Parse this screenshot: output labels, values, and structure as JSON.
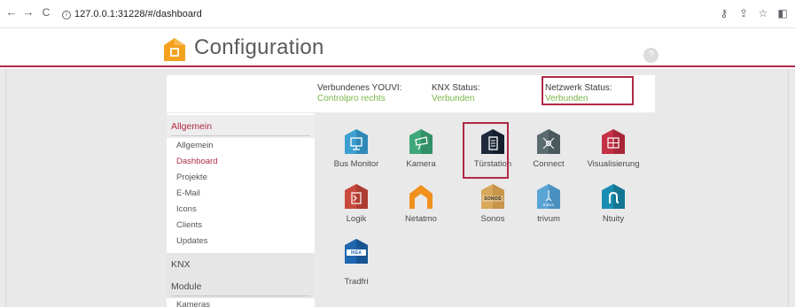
{
  "browser": {
    "back": "←",
    "forward": "→",
    "reload": "C",
    "url": "127.0.0.1:31228/#/dashboard",
    "icons": [
      "key-icon",
      "share-icon",
      "star-icon",
      "sidepanel-icon"
    ]
  },
  "header": {
    "title": "Configuration",
    "help": "?"
  },
  "status": {
    "youvi_label": "Verbundenes YOUVI:",
    "youvi_value": "Controlpro rechts",
    "knx_label": "KNX Status:",
    "knx_value": "Verbunden",
    "net_label": "Netzwerk Status:",
    "net_value": "Verbunden"
  },
  "sidebar": {
    "sections": [
      {
        "label": "Allgemein",
        "active": true
      },
      {
        "label": "KNX",
        "active": false
      },
      {
        "label": "Module",
        "active": false
      }
    ],
    "items": [
      "Allgemein",
      "Dashboard",
      "Projekte",
      "E-Mail",
      "Icons",
      "Clients",
      "Updates"
    ],
    "module_items": [
      "Kameras"
    ]
  },
  "tiles": [
    {
      "label": "Bus Monitor",
      "color": "#3d9fd1"
    },
    {
      "label": "Kamera",
      "color": "#3ea87a"
    },
    {
      "label": "Türstation",
      "color": "#1e2a3c"
    },
    {
      "label": "Connect",
      "color": "#5b6c6f"
    },
    {
      "label": "Visualisierung",
      "color": "#c43045"
    },
    {
      "label": "Logik",
      "color": "#c94a3c"
    },
    {
      "label": "Netatmo",
      "color": "#f0901f"
    },
    {
      "label": "Sonos",
      "color": "#d9a85a",
      "badge": "SONOS"
    },
    {
      "label": "trivum",
      "color": "#5aa4d4",
      "badge": "trivum"
    },
    {
      "label": "Ntuity",
      "color": "#1b8db2"
    },
    {
      "label": "Tradfri",
      "color": "#1f67b1",
      "badge": "IKEA"
    }
  ]
}
